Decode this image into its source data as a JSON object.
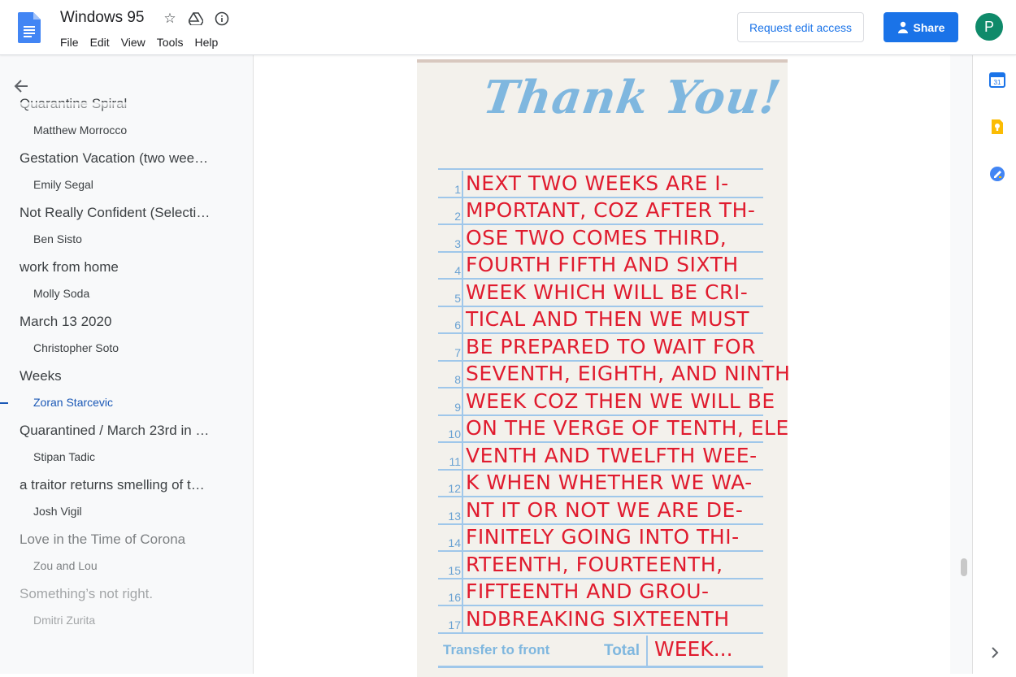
{
  "header": {
    "doc_title": "Windows 95",
    "menu": [
      "File",
      "Edit",
      "View",
      "Tools",
      "Help"
    ],
    "request_edit_label": "Request edit access",
    "share_label": "Share",
    "avatar_initial": "P"
  },
  "outline": {
    "items": [
      {
        "label": "Quarantine Spiral",
        "level": 1
      },
      {
        "label": "Matthew Morrocco",
        "level": 2
      },
      {
        "label": "Gestation Vacation (two wee…",
        "level": 1
      },
      {
        "label": "Emily Segal",
        "level": 2
      },
      {
        "label": "Not Really Confident (Selecti…",
        "level": 1
      },
      {
        "label": "Ben Sisto",
        "level": 2
      },
      {
        "label": "work from home",
        "level": 1
      },
      {
        "label": "Molly Soda",
        "level": 2
      },
      {
        "label": "March 13 2020",
        "level": 1
      },
      {
        "label": "Christopher Soto",
        "level": 2
      },
      {
        "label": "Weeks",
        "level": 1
      },
      {
        "label": "Zoran Starcevic",
        "level": 2,
        "active": true
      },
      {
        "label": "Quarantined / March 23rd in …",
        "level": 1
      },
      {
        "label": "Stipan Tadic",
        "level": 2
      },
      {
        "label": "a traitor returns smelling of t…",
        "level": 1
      },
      {
        "label": "Josh Vigil",
        "level": 2
      },
      {
        "label": "Love in the Time of Corona",
        "level": 1
      },
      {
        "label": "Zou and Lou",
        "level": 2
      },
      {
        "label": "Something’s not right.",
        "level": 1
      },
      {
        "label": "Dmitri Zurita",
        "level": 2
      }
    ]
  },
  "card": {
    "heading": "Thank You!",
    "lines": [
      {
        "n": "1",
        "text": "NEXT TWO WEEKS ARE I-"
      },
      {
        "n": "2",
        "text": "MPORTANT, COZ AFTER TH-"
      },
      {
        "n": "3",
        "text": "OSE TWO COMES THIRD,"
      },
      {
        "n": "4",
        "text": "FOURTH FIFTH AND SIXTH"
      },
      {
        "n": "5",
        "text": "WEEK WHICH WILL BE CRI-"
      },
      {
        "n": "6",
        "text": "TICAL AND THEN WE MUST"
      },
      {
        "n": "7",
        "text": "BE PREPARED TO WAIT FOR"
      },
      {
        "n": "8",
        "text": "SEVENTH, EIGHTH, AND NINTH"
      },
      {
        "n": "9",
        "text": "WEEK COZ THEN WE WILL BE"
      },
      {
        "n": "10",
        "text": "ON THE VERGE OF TENTH, ELE"
      },
      {
        "n": "11",
        "text": "VENTH AND TWELFTH WEE-"
      },
      {
        "n": "12",
        "text": "K WHEN WHETHER WE WA-"
      },
      {
        "n": "13",
        "text": "NT IT OR NOT WE ARE DE-"
      },
      {
        "n": "14",
        "text": "FINITELY GOING INTO THI-"
      },
      {
        "n": "15",
        "text": "RTEENTH, FOURTEENTH,"
      },
      {
        "n": "16",
        "text": "FIFTEENTH AND GROU-"
      },
      {
        "n": "17",
        "text": "NDBREAKING SIXTEENTH"
      }
    ],
    "transfer_label": "Transfer to front",
    "total_label": "Total",
    "total_value": "WEEK..."
  },
  "sidepanel": {
    "calendar_day": "31"
  }
}
